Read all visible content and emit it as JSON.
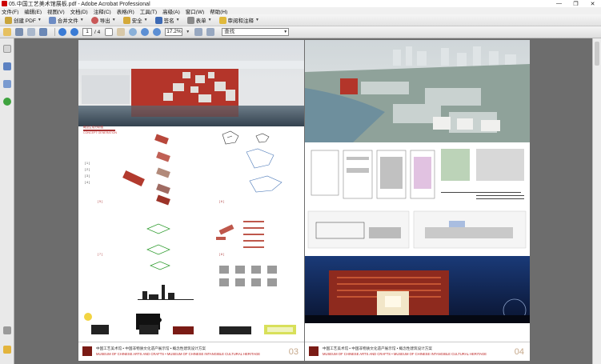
{
  "window": {
    "title": "05.中国工艺美术馆展板.pdf - Adobe Acrobat Professional",
    "controls": [
      "—",
      "❐",
      "✕"
    ]
  },
  "menu": [
    "文件(F)",
    "编辑(E)",
    "视图(V)",
    "文档(D)",
    "注释(C)",
    "表格(R)",
    "工具(T)",
    "高级(A)",
    "窗口(W)",
    "帮助(H)"
  ],
  "toolbar": {
    "create_pdf": "创建 PDF",
    "combine": "合并文件",
    "export": "导出",
    "secure": "安全",
    "sign": "签名",
    "forms": "表单",
    "review": "审阅和注释"
  },
  "nav": {
    "current_page": "1",
    "total_pages": "/ 4",
    "zoom": "17.2%",
    "search_placeholder": "查找"
  },
  "pages": [
    {
      "number": "03",
      "caption_cn": "中国工艺美术馆 • 中国非物质文化遗产展示馆 • 概念性建筑设计方案",
      "caption_en": "MUSEUM OF CHINESE ARTS AND CRAFTS • MUSEUM OF CHINESE INTANGIBLE CULTURAL HERITAGE",
      "labels": [
        "概念生成分析图",
        "CONCEPT GENERATION",
        "[ 1 ]",
        "[ 2 ]",
        "[ 3 ]",
        "[ 4 ]",
        "[ 5 ]",
        "[ 6 ]",
        "[ 7 ]",
        "[ 8 ]"
      ]
    },
    {
      "number": "04",
      "caption_cn": "中国工艺美术馆 • 中国非物质文化遗产展示馆 • 概念性建筑设计方案",
      "caption_en": "MUSEUM OF CHINESE ARTS AND CRAFTS • MUSEUM OF CHINESE INTANGIBLE CULTURAL HERITAGE"
    }
  ],
  "colors": {
    "accent_red": "#b33a2c",
    "brick": "#9c3328",
    "night": "#0e1a3a"
  }
}
